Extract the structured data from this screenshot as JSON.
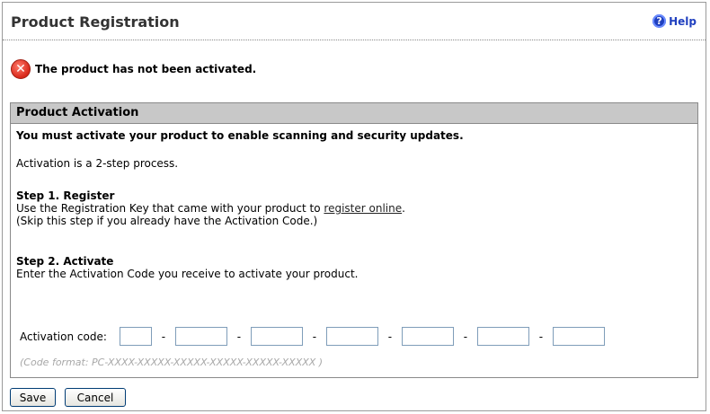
{
  "header": {
    "title": "Product Registration",
    "help_label": "Help",
    "help_icon": "?"
  },
  "alert": {
    "icon": "error-icon",
    "message": "The product has not been activated."
  },
  "panel": {
    "title": "Product Activation",
    "intro_bold": "You must activate your product to enable scanning and security updates.",
    "intro": "Activation is a 2-step process.",
    "step1": {
      "title": "Step 1. Register",
      "text_before_link": "Use the Registration Key that came with your product to ",
      "link": "register online",
      "text_after_link": ".",
      "note": "(Skip this step if you already have the Activation Code.)"
    },
    "step2": {
      "title": "Step 2. Activate",
      "text": "Enter the Activation Code you receive to activate your product."
    },
    "activation": {
      "label": "Activation code:",
      "segments": [
        "",
        "",
        "",
        "",
        "",
        "",
        ""
      ],
      "separator": "-",
      "format_hint": "(Code format: PC-XXXX-XXXXX-XXXXX-XXXXX-XXXXX-XXXXX )"
    }
  },
  "buttons": {
    "save": "Save",
    "cancel": "Cancel"
  },
  "colors": {
    "panel_header_bg": "#c8c8c8",
    "help_blue": "#1f3fbf",
    "error_red": "#d8281a",
    "hint_gray": "#a8a8a8"
  }
}
